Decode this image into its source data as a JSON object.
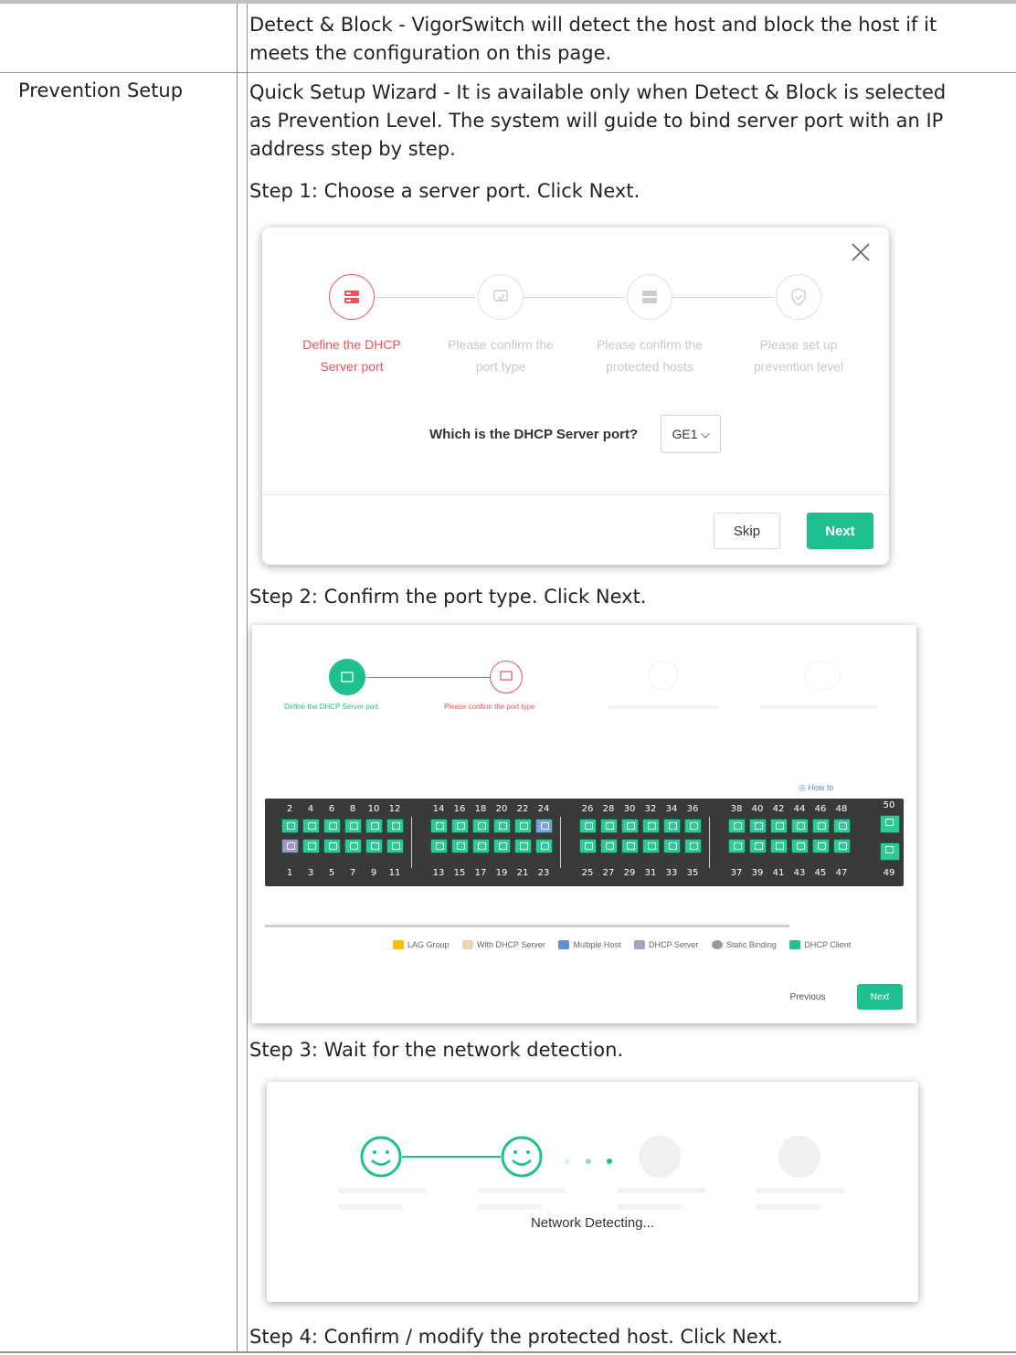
{
  "row1": {
    "text_line1": "Detect & Block - VigorSwitch will detect the host and block the host if it",
    "text_line2": "meets the configuration on this page."
  },
  "row2": {
    "label": "Prevention Setup",
    "intro_line1": "Quick Setup Wizard - It is available only when Detect & Block is selected",
    "intro_line2": "as Prevention Level. The system will guide to bind server port with an IP",
    "intro_line3": "address step by step.",
    "step1": "Step 1: Choose a server port. Click Next.",
    "step2": "Step 2: Confirm the port type. Click Next.",
    "step3": "Step 3: Wait for the network detection.",
    "step4": "Step 4: Confirm / modify the protected host. Click Next."
  },
  "wizard1": {
    "steps": [
      {
        "line1": "Define the DHCP",
        "line2": "Server port"
      },
      {
        "line1": "Please confirm the",
        "line2": "port type"
      },
      {
        "line1": "Please confirm the",
        "line2": "protected hosts"
      },
      {
        "line1": "Please set up",
        "line2": "prevention level"
      }
    ],
    "question": "Which is the DHCP Server port?",
    "port_value": "GE1",
    "skip": "Skip",
    "next": "Next",
    "colors": {
      "active": "#f0505a",
      "accent": "#1ec08d",
      "inactive": "#c8c8c8"
    }
  },
  "wizard2": {
    "step1_label": "Define the DHCP Server port",
    "step2_label": "Please confirm the port type",
    "how_to": "How to",
    "top_numbers": [
      "2",
      "4",
      "6",
      "8",
      "10",
      "12",
      "14",
      "16",
      "18",
      "20",
      "22",
      "24",
      "26",
      "28",
      "30",
      "32",
      "34",
      "36",
      "38",
      "40",
      "42",
      "44",
      "46",
      "48",
      "50"
    ],
    "bottom_numbers": [
      "1",
      "3",
      "5",
      "7",
      "9",
      "11",
      "13",
      "15",
      "17",
      "19",
      "21",
      "23",
      "25",
      "27",
      "29",
      "31",
      "33",
      "35",
      "37",
      "39",
      "41",
      "43",
      "45",
      "47",
      "49"
    ],
    "legend": [
      "LAG Group",
      "With DHCP Server",
      "Multiple Host",
      "DHCP Server",
      "Static Binding",
      "DHCP Client"
    ],
    "previous": "Previous",
    "next": "Next"
  },
  "wizard3": {
    "status": "Network Detecting..."
  }
}
